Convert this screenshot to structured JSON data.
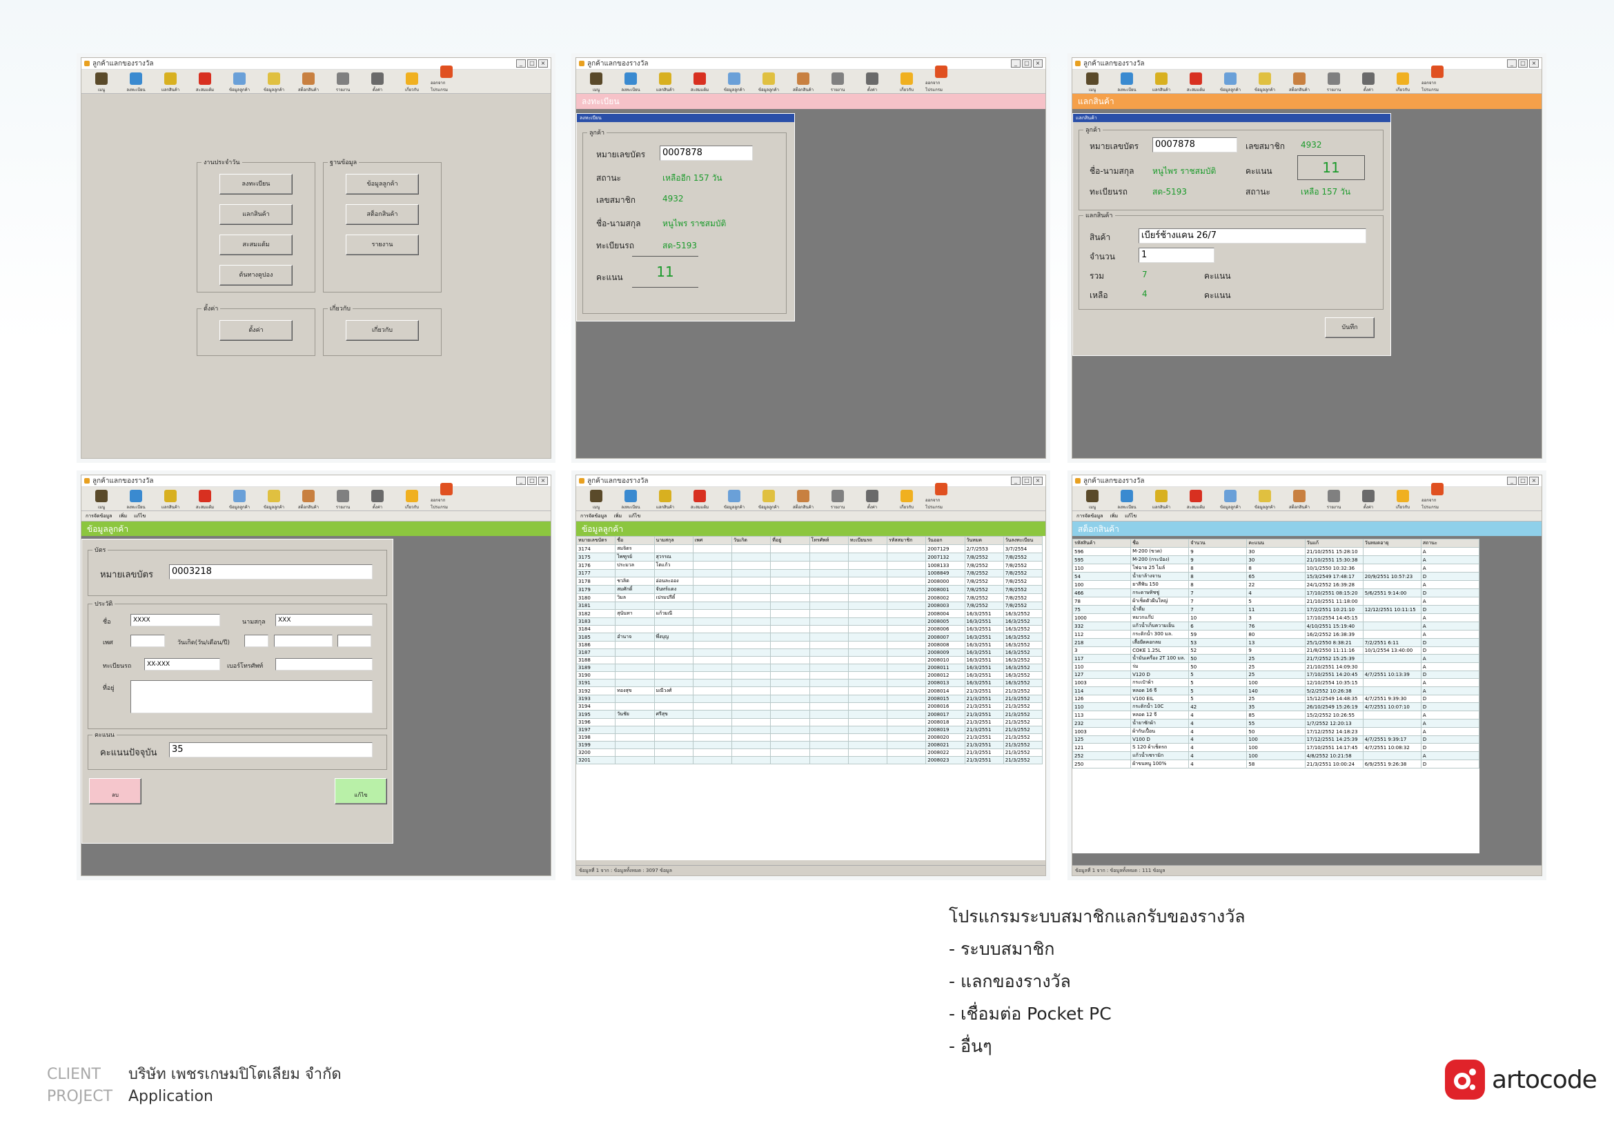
{
  "app_title": "ลูกค้าแลกของรางวัล",
  "toolbar": [
    "เมนู",
    "ลงทะเบียน",
    "แลกสินค้า",
    "สะสมแต้ม",
    "ข้อมูลลูกค้า",
    "ข้อมูลลูกค้า",
    "สต็อกสินค้า",
    "รายงาน",
    "ตั้งค่า",
    "เกี่ยวกับ",
    "ออกจากโปรแกรม"
  ],
  "subtabs": [
    "การจัดข้อมูล",
    "เพิ่ม",
    "แก้ไข"
  ],
  "s1": {
    "g1": "งานประจำวัน",
    "g2": "ฐานข้อมูล",
    "g3": "ตั้งค่า",
    "g4": "เกี่ยวกับ",
    "b": [
      "ลงทะเบียน",
      "แลกสินค้า",
      "สะสมแต้ม",
      "ต้นทางคูปอง",
      "ข้อมูลลูกค้า",
      "สต็อกสินค้า",
      "รายงาน",
      "ตั้งค่า",
      "เกี่ยวกับ"
    ]
  },
  "s2": {
    "strip": "ลงทะเบียน",
    "ptitle": "ลงทะเบียน",
    "legend": "ลูกค้า",
    "card_label": "หมายเลขบัตร",
    "card": "0007878",
    "status_label": "สถานะ",
    "status": "เหลืออีก 157 วัน",
    "member_label": "เลขสมาชิก",
    "member": "4932",
    "name_label": "ชื่อ-นามสกุล",
    "name": "หนูไพร ราชสมบัติ",
    "plate_label": "ทะเบียนรถ",
    "plate": "สด-5193",
    "score_label": "คะแนน",
    "score": "11"
  },
  "s3": {
    "strip": "แลกสินค้า",
    "ptitle": "แลกสินค้า",
    "legend1": "ลูกค้า",
    "legend2": "แลกสินค้า",
    "card": "0007878",
    "member": "4932",
    "name": "หนูไพร ราชสมบัติ",
    "score": "11",
    "plate": "สด-5193",
    "status": "เหลือ 157 วัน",
    "product_label": "สินค้า",
    "product": "เบียร์ช้างแคน   26/7",
    "qty_label": "จำนวน",
    "qty": "1",
    "total_label": "รวม",
    "total": "7",
    "remain_label": "เหลือ",
    "remain": "4",
    "unit": "คะแนน",
    "save": "บันทึก"
  },
  "s4": {
    "strip": "ข้อมูลลูกค้า",
    "legend_card": "บัตร",
    "card_label": "หมายเลขบัตร",
    "card": "0003218",
    "legend_profile": "ประวัติ",
    "fname_label": "ชื่อ",
    "fname": "XXXX",
    "lname_label": "นามสกุล",
    "lname": "XXX",
    "sex_label": "เพศ",
    "dob_label": "วันเกิด(วัน/เดือน/ปี)",
    "plate_label": "ทะเบียนรถ",
    "plate": "XX-XXX",
    "phone_label": "เบอร์โทรศัพท์",
    "addr_label": "ที่อยู่",
    "legend_score": "คะแนน",
    "score_label": "คะแนนปัจจุบัน",
    "score": "35",
    "del": "ลบ",
    "save": "แก้ไข"
  },
  "s5": {
    "strip": "ข้อมูลลูกค้า",
    "headers": [
      "หมายเลขบัตร",
      "ชื่อ",
      "นามสกุล",
      "เพศ",
      "วันเกิด",
      "ที่อยู่",
      "โทรศัพท์",
      "ทะเบียนรถ",
      "รหัสสมาชิก",
      "วันออก",
      "วันหมด",
      "วันลงทะเบียน"
    ],
    "rows": [
      [
        "3174",
        "สมจิตร",
        "",
        "",
        "",
        "",
        "",
        "",
        "",
        "2007129",
        "2/7/2553",
        "3/7/2554"
      ],
      [
        "3175",
        "ไพฑูรย์",
        "สุวรรณ",
        "",
        "",
        "",
        "",
        "",
        "",
        "2007132",
        "7/8/2552",
        "7/8/2552"
      ],
      [
        "3176",
        "ประมวล",
        "โตแก้ว",
        "",
        "",
        "",
        "",
        "",
        "",
        "1008133",
        "7/8/2552",
        "7/8/2552"
      ],
      [
        "3177",
        "",
        "",
        "",
        "",
        "",
        "",
        "",
        "",
        "1008849",
        "7/8/2552",
        "7/8/2552"
      ],
      [
        "3178",
        "ชวลิต",
        "อ่อนละออง",
        "",
        "",
        "",
        "",
        "",
        "",
        "2008000",
        "7/8/2552",
        "7/8/2552"
      ],
      [
        "3179",
        "สมศักดิ์",
        "จันทร์แดง",
        "",
        "",
        "",
        "",
        "",
        "",
        "2008001",
        "7/8/2552",
        "7/8/2552"
      ],
      [
        "3180",
        "วิมล",
        "เปรมปรีดิ์",
        "",
        "",
        "",
        "",
        "",
        "",
        "2008002",
        "7/8/2552",
        "7/8/2552"
      ],
      [
        "3181",
        "",
        "",
        "",
        "",
        "",
        "",
        "",
        "",
        "2008003",
        "7/8/2552",
        "7/8/2552"
      ],
      [
        "3182",
        "สุนันทา",
        "แก้วมณี",
        "",
        "",
        "",
        "",
        "",
        "",
        "2008004",
        "16/3/2551",
        "16/3/2552"
      ],
      [
        "3183",
        "",
        "",
        "",
        "",
        "",
        "",
        "",
        "",
        "2008005",
        "16/3/2551",
        "16/3/2552"
      ],
      [
        "3184",
        "",
        "",
        "",
        "",
        "",
        "",
        "",
        "",
        "2008006",
        "16/3/2551",
        "16/3/2552"
      ],
      [
        "3185",
        "อำนาจ",
        "พึ่งบุญ",
        "",
        "",
        "",
        "",
        "",
        "",
        "2008007",
        "16/3/2551",
        "16/3/2552"
      ],
      [
        "3186",
        "",
        "",
        "",
        "",
        "",
        "",
        "",
        "",
        "2008008",
        "16/3/2551",
        "16/3/2552"
      ],
      [
        "3187",
        "",
        "",
        "",
        "",
        "",
        "",
        "",
        "",
        "2008009",
        "16/3/2551",
        "16/3/2552"
      ],
      [
        "3188",
        "",
        "",
        "",
        "",
        "",
        "",
        "",
        "",
        "2008010",
        "16/3/2551",
        "16/3/2552"
      ],
      [
        "3189",
        "",
        "",
        "",
        "",
        "",
        "",
        "",
        "",
        "2008011",
        "16/3/2551",
        "16/3/2552"
      ],
      [
        "3190",
        "",
        "",
        "",
        "",
        "",
        "",
        "",
        "",
        "2008012",
        "16/3/2551",
        "16/3/2552"
      ],
      [
        "3191",
        "",
        "",
        "",
        "",
        "",
        "",
        "",
        "",
        "2008013",
        "16/3/2551",
        "16/3/2552"
      ],
      [
        "3192",
        "ทองสุข",
        "มณีวงศ์",
        "",
        "",
        "",
        "",
        "",
        "",
        "2008014",
        "21/3/2551",
        "21/3/2552"
      ],
      [
        "3193",
        "",
        "",
        "",
        "",
        "",
        "",
        "",
        "",
        "2008015",
        "21/3/2551",
        "21/3/2552"
      ],
      [
        "3194",
        "",
        "",
        "",
        "",
        "",
        "",
        "",
        "",
        "2008016",
        "21/3/2551",
        "21/3/2552"
      ],
      [
        "3195",
        "วันชัย",
        "ศรีสุข",
        "",
        "",
        "",
        "",
        "",
        "",
        "2008017",
        "21/3/2551",
        "21/3/2552"
      ],
      [
        "3196",
        "",
        "",
        "",
        "",
        "",
        "",
        "",
        "",
        "2008018",
        "21/3/2551",
        "21/3/2552"
      ],
      [
        "3197",
        "",
        "",
        "",
        "",
        "",
        "",
        "",
        "",
        "2008019",
        "21/3/2551",
        "21/3/2552"
      ],
      [
        "3198",
        "",
        "",
        "",
        "",
        "",
        "",
        "",
        "",
        "2008020",
        "21/3/2551",
        "21/3/2552"
      ],
      [
        "3199",
        "",
        "",
        "",
        "",
        "",
        "",
        "",
        "",
        "2008021",
        "21/3/2551",
        "21/3/2552"
      ],
      [
        "3200",
        "",
        "",
        "",
        "",
        "",
        "",
        "",
        "",
        "2008022",
        "21/3/2551",
        "21/3/2552"
      ],
      [
        "3201",
        "",
        "",
        "",
        "",
        "",
        "",
        "",
        "",
        "2008023",
        "21/3/2551",
        "21/3/2552"
      ]
    ],
    "status": "ข้อมูลที่ 1 จาก : ข้อมูลทั้งหมด : 3097 ข้อมูล"
  },
  "s6": {
    "strip": "สต็อกสินค้า",
    "headers": [
      "รหัสสินค้า",
      "ชื่อ",
      "จำนวน",
      "คะแนน",
      "วันแก้",
      "วันหมดอายุ",
      "สถานะ"
    ],
    "rows": [
      [
        "596",
        "M-200 (ขวด)",
        "9",
        "30",
        "21/10/2551 15:28:10",
        "",
        "A"
      ],
      [
        "595",
        "M-200 (กระป๋อง)",
        "9",
        "30",
        "21/10/2551 15:30:38",
        "",
        "A"
      ],
      [
        "110",
        "ไฟฉาย 25 ไมล์",
        "8",
        "8",
        "10/1/2550 10:32:36",
        "",
        "A"
      ],
      [
        "54",
        "น้ำยาล้างจาน",
        "8",
        "65",
        "15/3/2549 17:48:17",
        "20/9/2551 10:57:23",
        "D"
      ],
      [
        "100",
        "ยาสีฟัน 150",
        "8",
        "22",
        "24/1/2552 16:39:28",
        "",
        "A"
      ],
      [
        "466",
        "กระดาษทิชชู่",
        "7",
        "4",
        "17/10/2551 08:15:20",
        "5/6/2551 9:14:00",
        "D"
      ],
      [
        "78",
        "ผ้าเช็ดตัวผืนใหญ่",
        "7",
        "5",
        "21/10/2551 11:18:00",
        "",
        "A"
      ],
      [
        "75",
        "น้ำดื่ม",
        "7",
        "11",
        "17/2/2551 10:21:10",
        "12/12/2551 10:11:15",
        "D"
      ],
      [
        "1000",
        "หมวกแก๊ป",
        "10",
        "3",
        "17/10/2554 14:45:15",
        "",
        "A"
      ],
      [
        "332",
        "แก้วน้ำเก็บความเย็น",
        "6",
        "76",
        "4/10/2551 15:19:40",
        "",
        "A"
      ],
      [
        "112",
        "กระติกน้ำ 300 มล.",
        "59",
        "80",
        "16/2/2552 16:38:39",
        "",
        "A"
      ],
      [
        "218",
        "เสื้อยืดคอกลม",
        "53",
        "13",
        "25/1/2550 8:38:21",
        "7/2/2551 6:11",
        "D"
      ],
      [
        "3",
        "COKE 1.25L",
        "52",
        "9",
        "21/8/2550 11:11:16",
        "10/1/2554 13:40:00",
        "D"
      ],
      [
        "117",
        "น้ำมันเครื่อง 2T 100 มล.",
        "50",
        "25",
        "21/7/2552 15:25:39",
        "",
        "A"
      ],
      [
        "110",
        "ร่ม",
        "50",
        "25",
        "21/10/2551 14:09:30",
        "",
        "A"
      ],
      [
        "127",
        "V120 D",
        "5",
        "25",
        "17/10/2551 14:20:45",
        "4/7/2551 10:13:39",
        "D"
      ],
      [
        "1003",
        "กระเป๋าผ้า",
        "5",
        "100",
        "12/10/2554 10:35:15",
        "",
        "A"
      ],
      [
        "114",
        "หลอด 16 จี",
        "5",
        "140",
        "5/2/2552 10:26:38",
        "",
        "A"
      ],
      [
        "126",
        "V100 EIL",
        "5",
        "25",
        "15/12/2549 14:48:35",
        "4/7/2551 9:39:30",
        "D"
      ],
      [
        "110",
        "กระติกน้ำ 10C",
        "42",
        "35",
        "26/10/2549 15:26:19",
        "4/7/2551 10:07:10",
        "D"
      ],
      [
        "113",
        "หลอด 12 จี",
        "4",
        "85",
        "15/2/2552 10:26:55",
        "",
        "A"
      ],
      [
        "232",
        "น้ำยาซักผ้า",
        "4",
        "55",
        "1/7/2552 12:20:13",
        "",
        "A"
      ],
      [
        "1003",
        "ผ้ากันเปื้อน",
        "4",
        "50",
        "17/12/2552 14:18:23",
        "",
        "A"
      ],
      [
        "125",
        "V100 D",
        "4",
        "100",
        "17/12/2551 14:25:39",
        "4/7/2551 9:39:17",
        "D"
      ],
      [
        "121",
        "S 120 ผ้าเช็ดรถ",
        "4",
        "100",
        "17/10/2551 14:17:45",
        "4/7/2551 10:08:32",
        "D"
      ],
      [
        "252",
        "แก้วน้ำเซรามิก",
        "4",
        "100",
        "4/8/2552 10:21:58",
        "",
        "A"
      ],
      [
        "250",
        "ผ้าขนหนู 100%",
        "4",
        "58",
        "21/3/2551 10:00:24",
        "6/9/2551 9:26:38",
        "D"
      ]
    ],
    "status": "ข้อมูลที่ 1 จาก : ข้อมูลทั้งหมด : 111 ข้อมูล"
  },
  "caption": {
    "title": "โปรแกรมระบบสมาชิกแลกรับของรางวัล",
    "items": [
      "- ระบบสมาชิก",
      "- แลกของรางวัล",
      "- เชื่อมต่อ Pocket PC",
      "- อื่นๆ"
    ]
  },
  "client": {
    "client_label": "CLIENT",
    "client": "บริษัท เพชรเกษมปิโตเลียม จำกัด",
    "project_label": "PROJECT",
    "project": "Application"
  },
  "brand": "artocode",
  "colors": {
    "pink": "#f6c2c8",
    "orange": "#f5a04a",
    "green": "#8cc63f",
    "blue": "#8fd0ea",
    "red": "#e0232a",
    "score": "#1a9a2a"
  }
}
